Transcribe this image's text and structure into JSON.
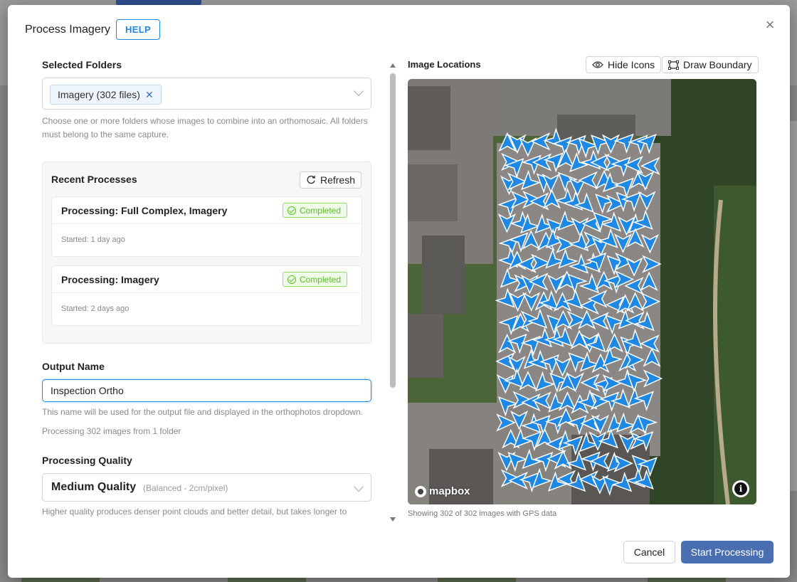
{
  "modal": {
    "title": "Process Imagery",
    "help_label": "HELP",
    "close_label": "×"
  },
  "selected_folders": {
    "label": "Selected Folders",
    "tags": [
      {
        "label": "Imagery (302 files)",
        "remove": "✕"
      }
    ],
    "hint": "Choose one or more folders whose images to combine into an orthomosaic. All folders must belong to the same capture."
  },
  "recent_processes": {
    "title": "Recent Processes",
    "refresh_label": "Refresh",
    "items": [
      {
        "title": "Processing: Full Complex, Imagery",
        "status": "Completed",
        "started": "Started: 1 day ago"
      },
      {
        "title": "Processing: Imagery",
        "status": "Completed",
        "started": "Started: 2 days ago"
      }
    ]
  },
  "output_name": {
    "label": "Output Name",
    "value": "Inspection Ortho",
    "hint": "This name will be used for the output file and displayed in the orthophotos dropdown.",
    "summary": "Processing 302 images from 1 folder"
  },
  "processing_quality": {
    "label": "Processing Quality",
    "selected": "Medium Quality",
    "selected_detail": "(Balanced - 2cm/pixel)",
    "hint": "Higher quality produces denser point clouds and better detail, but takes longer to process."
  },
  "map": {
    "title": "Image Locations",
    "hide_icons_label": "Hide Icons",
    "draw_boundary_label": "Draw Boundary",
    "attribution": "mapbox",
    "info_label": "i",
    "status": "Showing 302 of 302 images with GPS data",
    "marker_color": "#1e88e5"
  },
  "footer": {
    "cancel_label": "Cancel",
    "start_label": "Start Processing"
  },
  "colors": {
    "accent": "#1e88e5",
    "primary_button": "#4a6fb0",
    "success": "#52c41a"
  }
}
